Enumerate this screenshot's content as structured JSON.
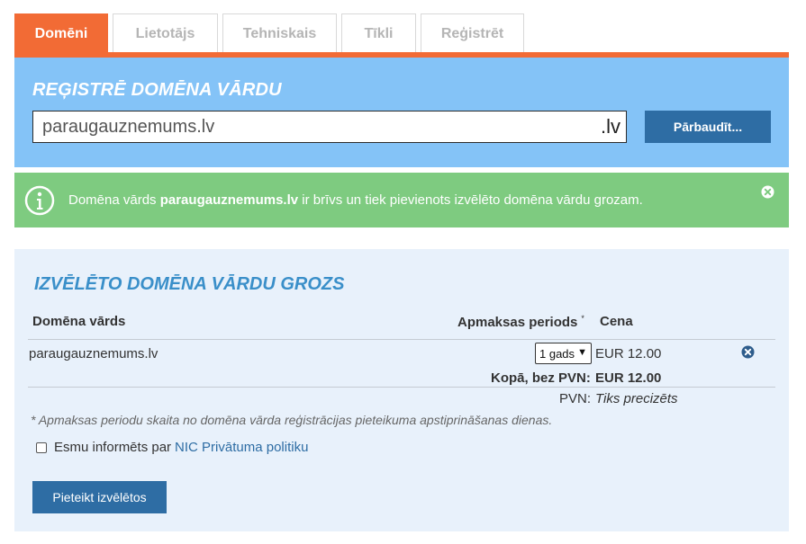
{
  "tabs": [
    {
      "label": "Domēni",
      "active": true
    },
    {
      "label": "Lietotājs",
      "active": false
    },
    {
      "label": "Tehniskais",
      "active": false
    },
    {
      "label": "Tīkli",
      "active": false
    },
    {
      "label": "Reģistrēt",
      "active": false
    }
  ],
  "register": {
    "title": "REĢISTRĒ DOMĒNA VĀRDU",
    "input_value": "paraugauznemums.lv",
    "tld": ".lv",
    "check_label": "Pārbaudīt..."
  },
  "alert": {
    "prefix": "Domēna vārds ",
    "domain": "paraugauznemums.lv",
    "suffix": " ir brīvs un tiek pievienots izvēlēto domēna vārdu grozam.",
    "icon": "info-icon"
  },
  "cart": {
    "title": "IZVĒLĒTO DOMĒNA VĀRDU GROZS",
    "headers": {
      "name": "Domēna vārds",
      "period": "Apmaksas periods",
      "period_mark": "*",
      "price": "Cena"
    },
    "rows": [
      {
        "domain": "paraugauznemums.lv",
        "period": "1 gads",
        "price": "EUR 12.00"
      }
    ],
    "total_label": "Kopā, bez PVN:",
    "total_value": "EUR 12.00",
    "vat_label": "PVN:",
    "vat_value": "Tiks precizēts",
    "note": "* Apmaksas periodu skaita no domēna vārda reģistrācijas pieteikuma apstiprināšanas dienas.",
    "consent_prefix": "Esmu informēts par",
    "consent_link": "NIC Privātuma politiku",
    "submit_label": "Pieteikt izvēlētos"
  },
  "colors": {
    "accent": "#f26b35",
    "panel_blue": "#84c3f7",
    "success_green": "#7ecb80",
    "cart_bg": "#e8f1fb",
    "button_blue": "#2e6da4",
    "title_blue": "#3a8fc9"
  }
}
